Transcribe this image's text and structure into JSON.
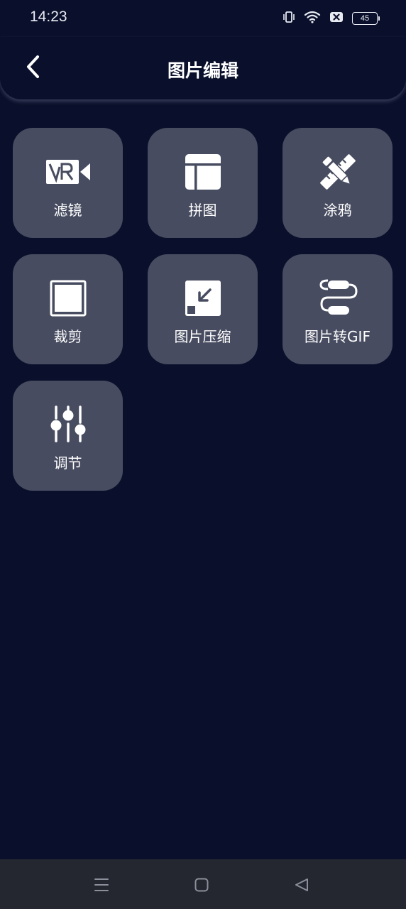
{
  "status_bar": {
    "time": "14:23",
    "battery": "45",
    "icons": [
      "vibrate-icon",
      "wifi-icon",
      "sim-blocked-icon",
      "battery-icon"
    ]
  },
  "header": {
    "title": "图片编辑",
    "back_icon": "chevron-left-icon"
  },
  "tools": [
    {
      "label": "滤镜",
      "icon": "vr-camera-icon"
    },
    {
      "label": "拼图",
      "icon": "layout-grid-icon"
    },
    {
      "label": "涂鸦",
      "icon": "pencil-ruler-icon"
    },
    {
      "label": "裁剪",
      "icon": "crop-square-icon"
    },
    {
      "label": "图片压缩",
      "icon": "compress-arrow-icon"
    },
    {
      "label": "图片转GIF",
      "icon": "gif-convert-icon"
    },
    {
      "label": "调节",
      "icon": "sliders-icon"
    }
  ],
  "nav_bar": {
    "icons": [
      "menu-icon",
      "home-icon",
      "back-triangle-icon"
    ]
  },
  "colors": {
    "background": "#0a102b",
    "tile": "#474c60",
    "nav_bar": "#242730",
    "text": "#ffffff"
  }
}
